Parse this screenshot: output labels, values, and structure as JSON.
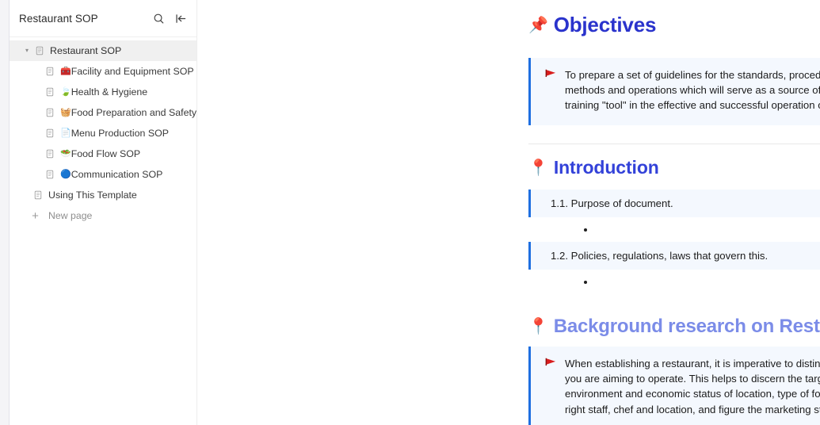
{
  "sidebar": {
    "title": "Restaurant SOP",
    "search_icon": "search-icon",
    "collapse_icon": "collapse-sidebar-icon",
    "tree": {
      "root": {
        "label": "Restaurant SOP",
        "caret": "▾",
        "selected": true
      },
      "children": [
        {
          "emoji": "🧰",
          "label": "Facility and Equipment SOP"
        },
        {
          "emoji": "🍃",
          "label": "Health & Hygiene"
        },
        {
          "emoji": "🧺",
          "label": "Food Preparation and Safety"
        },
        {
          "emoji": "📄",
          "label": "Menu Production SOP"
        },
        {
          "emoji": "🥗",
          "label": "Food Flow SOP"
        },
        {
          "emoji": "🔵",
          "label": "Communication SOP"
        }
      ],
      "flat_items": [
        {
          "label": "Using This Template"
        }
      ],
      "new_page": {
        "label": "New page",
        "icon": "plus-icon"
      }
    }
  },
  "main": {
    "sections": [
      {
        "emoji": "📌",
        "heading": "Objectives",
        "heading_color": "#2a33cc",
        "callout": {
          "marker": "red-flag",
          "text": "To prepare a set of guidelines for the standards, procedures, processes, product, business methods and operations which will  serve as a source of information, reference, guide and training \"tool\" in the effective and successful operation of a restaurant."
        }
      },
      {
        "emoji": "📍",
        "heading": "Introduction",
        "heading_color": "#3342d9",
        "items": [
          {
            "text": "1.1. Purpose of document."
          },
          {
            "text": "1.2. Policies, regulations, laws that govern this."
          }
        ]
      },
      {
        "emoji": "📍",
        "heading": "Background research on Restaurant Concept",
        "heading_color": "#7b8ce8",
        "callout": {
          "marker": "red-flag",
          "text": "When establishing a restaurant, it is imperative to distinguish the restaurant concept that you are aiming to operate. This helps to discern the target market, know more about the environment and economic status of location, type of food and size the menu, select the right staff, chef and location, and figure the marketing strategy that will best fit your needs."
        }
      }
    ]
  },
  "colors": {
    "callout_bg": "#f4f8fe",
    "callout_border": "#1f6fe0",
    "sidebar_selected": "#f0f0f0",
    "divider": "#e8e8e8"
  }
}
